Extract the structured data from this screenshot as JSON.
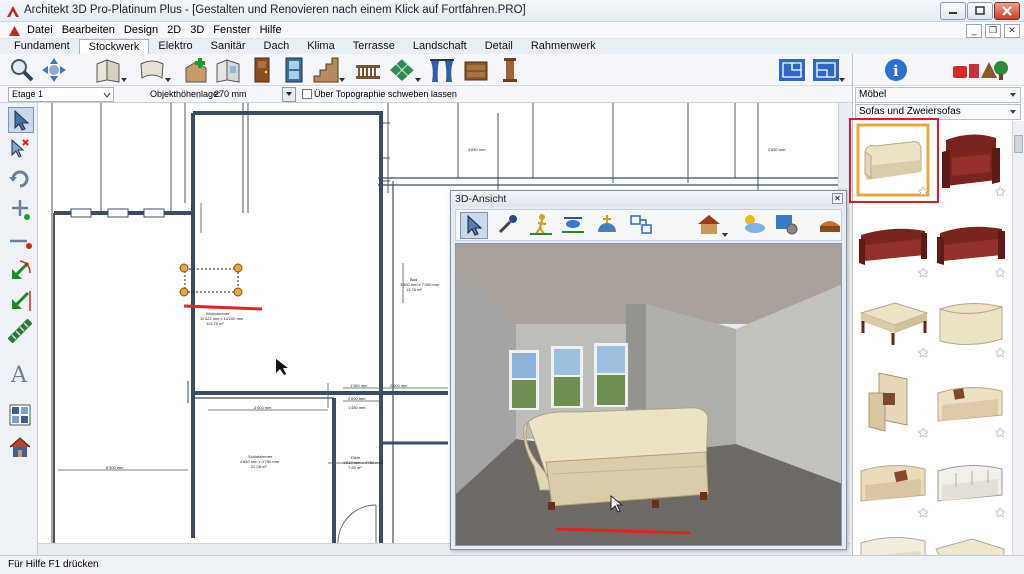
{
  "window": {
    "title": "Architekt 3D Pro-Platinum Plus - [Gestalten und Renovieren nach einem Klick auf Fortfahren.PRO]",
    "minimize_label": "–",
    "restore_label": "❐",
    "close_label": "✕"
  },
  "menu": {
    "items": [
      "Datei",
      "Bearbeiten",
      "Design",
      "2D",
      "3D",
      "Fenster",
      "Hilfe"
    ],
    "mdi_minimize": "_",
    "mdi_restore": "❐",
    "mdi_close": "✕"
  },
  "tabs": {
    "items": [
      "Fundament",
      "Stockwerk",
      "Elektro",
      "Sanitär",
      "Dach",
      "Klima",
      "Terrasse",
      "Landschaft",
      "Detail",
      "Rahmenwerk"
    ],
    "active": "Stockwerk"
  },
  "options": {
    "floor_select": "Etage 1",
    "height_label": "Objekthöhenlage:",
    "height_value": "270 mm",
    "topo_checkbox_label": "Über Topographie schweben lassen"
  },
  "plan": {
    "room1_name": "Wohnzimmer",
    "room1_dims": "11'422 mm x 14'200 mm",
    "room1_area": "113,75 m²",
    "room2_name": "Bad",
    "room2_dims": "3'600 mm x 7'450 mm",
    "room2_area": "13,76 m²",
    "room3_name": "Schlafzimmer",
    "room3_dims": "4'650 mm x 4'750 mm",
    "room3_area": "22,08 m²",
    "room4_name": "Diele",
    "room4_dims": "1'610 mm x 4'750 mm",
    "room4_area": "7,65 m²",
    "dim_a": "1'450 mm",
    "dim_b": "2'600 mm",
    "dim_c": "2'000 mm",
    "dim_d": "1'450 mm",
    "dim_e": "8'300 mm",
    "dim_f": "2'000 mm",
    "dim_g": "4'650 mm",
    "dim_h": "2'650 mm"
  },
  "view3d": {
    "title": "3D-Ansicht",
    "close_label": "✕"
  },
  "right_panel": {
    "category": "Möbel",
    "subcategory": "Sofas und Zweiersofas"
  },
  "statusbar": {
    "text": "Für Hilfe F1 drücken"
  },
  "icons": [
    "zoom-icon",
    "pan-icon",
    "wall-icon",
    "curved-wall-icon",
    "add-room-icon",
    "window-icon",
    "door-icon",
    "cabinet-icon",
    "stairs-icon",
    "railing-icon",
    "floor-pattern-icon",
    "curtain-icon",
    "dresser-icon",
    "column-icon",
    "plan-view-icon",
    "info-icon",
    "furniture-catalog-icon",
    "select-arrow-icon",
    "select-plus-icon",
    "rotate-icon",
    "add-point-icon",
    "line-icon",
    "arrow-icon",
    "hatch-icon",
    "text-icon",
    "texture-icon",
    "house-icon"
  ],
  "colors": {
    "accent": "#1a4fa0",
    "wall": "#3d4c66",
    "selection": "#e8a83a",
    "annotation_red": "#e32222",
    "highlight_box": "#e0192d",
    "sofa_burgundy": "#7a2420",
    "sofa_cream": "#ece2c6"
  }
}
